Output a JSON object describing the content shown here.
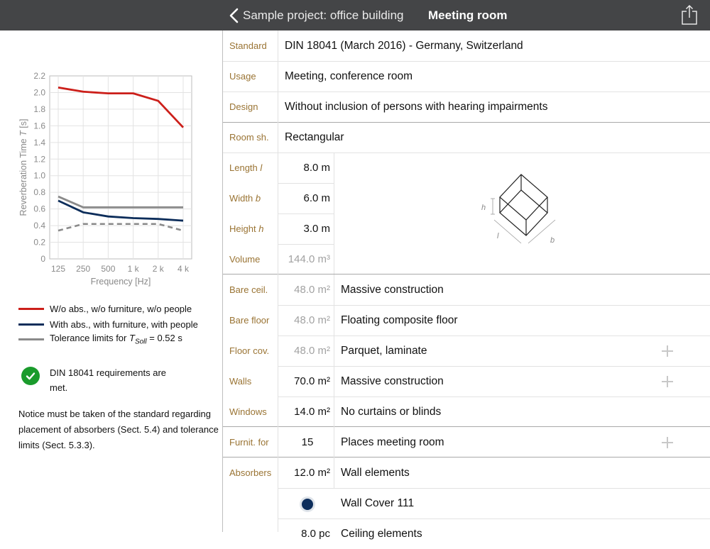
{
  "header": {
    "back_label": "Sample project: office building",
    "title": "Meeting room"
  },
  "chart_data": {
    "type": "line",
    "xlabel": "Frequency [Hz]",
    "ylabel_main": "Reverberation Time",
    "ylabel_var": "T",
    "ylabel_unit": "[s]",
    "categories": [
      "125",
      "250",
      "500",
      "1 k",
      "2 k",
      "4 k"
    ],
    "yticks": [
      "0",
      "0.2",
      "0.4",
      "0.6",
      "0.8",
      "1.0",
      "1.2",
      "1.4",
      "1.6",
      "1.8",
      "2.0",
      "2.2"
    ],
    "ylim": [
      0,
      2.2
    ],
    "grid": true,
    "series": [
      {
        "name": "W/o abs., w/o furniture, w/o people",
        "color": "#cc1f1a",
        "values": [
          2.06,
          2.01,
          1.99,
          1.99,
          1.9,
          1.58
        ]
      },
      {
        "name": "With abs., with furniture, with people",
        "color": "#0c2d5a",
        "values": [
          0.7,
          0.56,
          0.51,
          0.49,
          0.48,
          0.46
        ]
      },
      {
        "name": "Tolerance limits upper",
        "color": "#8a8a8a",
        "values": [
          0.75,
          0.62,
          0.62,
          0.62,
          0.62,
          0.62
        ]
      },
      {
        "name": "Tolerance limits lower",
        "color": "#8a8a8a",
        "dashed": true,
        "values": [
          0.34,
          0.42,
          0.42,
          0.42,
          0.42,
          0.34
        ]
      }
    ]
  },
  "legend": [
    {
      "text": "W/o abs., w/o furniture, w/o people",
      "color": "#cc1f1a"
    },
    {
      "text": "With abs., with furniture, with people",
      "color": "#0c2d5a"
    },
    {
      "prefix": "Tolerance limits for ",
      "var": "T",
      "sub": "Soll",
      "suffix": " = 0.52 s",
      "color": "#8a8a8a"
    }
  ],
  "status": {
    "text": "DIN 18041 requirements are met.",
    "color": "#1a9b2c"
  },
  "notice": "Notice must be taken of the standard regarding placement of absorbers (Sect. 5.4) and tolerance limits (Sect. 5.3.3).",
  "form": {
    "standard": {
      "label": "Standard",
      "value": "DIN 18041 (March 2016) - Germany, Switzerland"
    },
    "usage": {
      "label": "Usage",
      "value": "Meeting, conference room"
    },
    "design": {
      "label": "Design",
      "value": "Without inclusion of persons with hearing impairments"
    },
    "room_shape": {
      "label": "Room sh.",
      "value": "Rectangular"
    },
    "length": {
      "label": "Length ",
      "var": "l",
      "value": "8.0 m"
    },
    "width": {
      "label": "Width ",
      "var": "b",
      "value": "6.0 m"
    },
    "height": {
      "label": "Height ",
      "var": "h",
      "value": "3.0 m"
    },
    "volume": {
      "label": "Volume",
      "value": "144.0 m³"
    },
    "room_dims": {
      "h": "h",
      "l": "l",
      "b": "b"
    },
    "bare_ceiling": {
      "label": "Bare ceil.",
      "value": "48.0 m²",
      "desc": "Massive construction"
    },
    "bare_floor": {
      "label": "Bare floor",
      "value": "48.0 m²",
      "desc": "Floating composite floor"
    },
    "floor_cov": {
      "label": "Floor cov.",
      "value": "48.0 m²",
      "desc": "Parquet, laminate"
    },
    "walls": {
      "label": "Walls",
      "value": "70.0 m²",
      "desc": "Massive construction"
    },
    "windows": {
      "label": "Windows",
      "value": "14.0 m²",
      "desc": "No curtains or blinds"
    },
    "furniture": {
      "label": "Furnit. for",
      "value": "15",
      "desc": "Places meeting room"
    },
    "absorbers": {
      "label": "Absorbers",
      "value": "12.0 m²",
      "desc": "Wall elements"
    },
    "absorber_item": {
      "desc": "Wall Cover 111"
    },
    "ceiling_elements": {
      "value": "8.0 pc",
      "desc": "Ceiling elements"
    }
  }
}
